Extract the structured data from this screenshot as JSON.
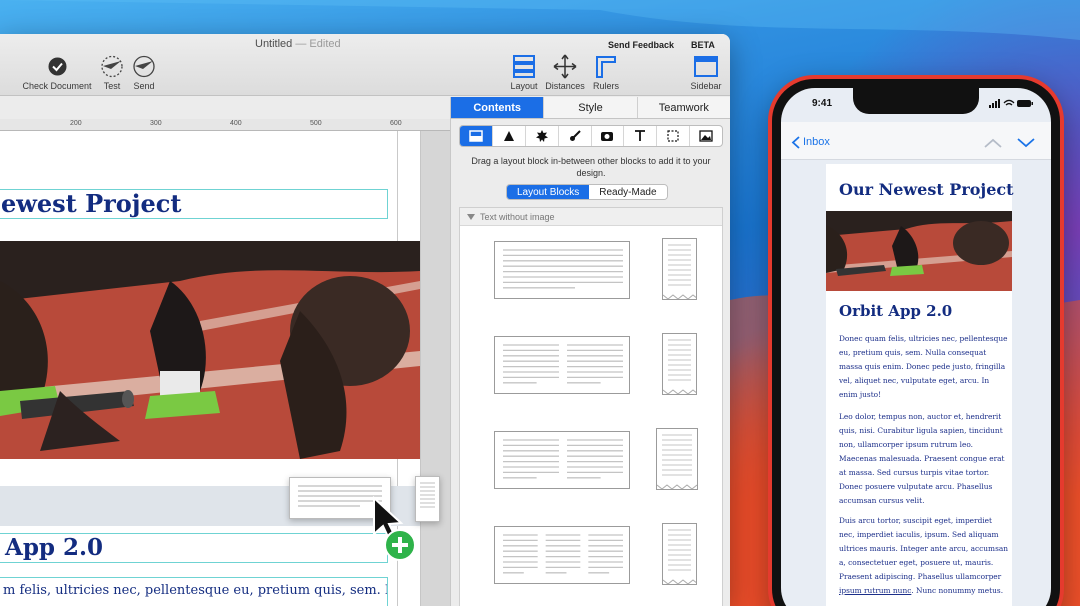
{
  "window": {
    "title": "Untitled",
    "title_sep": " — ",
    "title_state": "Edited",
    "send_feedback": "Send Feedback",
    "beta": "BETA"
  },
  "toolbar": {
    "check_document": "Check Document",
    "test": "Test",
    "send": "Send",
    "layout": "Layout",
    "distances": "Distances",
    "rulers": "Rulers",
    "sidebar": "Sidebar"
  },
  "ruler": {
    "ticks": [
      "200",
      "300",
      "400",
      "500",
      "600"
    ]
  },
  "canvas": {
    "headline": "Newest Project",
    "subheadline": "App 2.0",
    "body": "m felis, ultricies nec, pellentesque eu, pretium quis, sem. Nulla"
  },
  "sidebar": {
    "tabs": [
      "Contents",
      "Style",
      "Teamwork"
    ],
    "active_tab": "Contents",
    "icons": [
      "layout-block-icon",
      "shape-triangle-icon",
      "badge-burst-icon",
      "brush-icon",
      "camera-icon",
      "text-icon",
      "selection-icon",
      "image-icon"
    ],
    "hint": "Drag a layout block in-between other blocks to add it to your design.",
    "segments": [
      "Layout Blocks",
      "Ready-Made"
    ],
    "active_segment": "Layout Blocks",
    "section_title": "Text without image"
  },
  "phone": {
    "time": "9:41",
    "back_label": "Inbox",
    "email": {
      "title": "Our Newest Project",
      "subtitle": "Orbit App 2.0",
      "p1": "Donec quam felis, ultricies nec, pellentesque eu, pretium quis, sem. Nulla consequat massa quis enim. Donec pede justo, fringilla vel, aliquet nec, vulputate eget, arcu. In enim justo!",
      "p2": "Leo dolor, tempus non, auctor et, hendrerit quis, nisi. Curabitur ligula sapien, tincidunt non, ullamcorper ipsum rutrum leo. Maecenas malesuada. Praesent congue erat at massa. Sed cursus turpis vitae tortor. Donec posuere vulputate arcu. Phasellus accumsan cursus velit.",
      "p3_a": "Duis arcu tortor, suscipit eget, imperdiet nec, imperdiet iaculis, ipsum. Sed aliquam ultrices mauris. Integer ante arcu, accumsan a, consectetuer eget, posuere ut, mauris. Praesent adipiscing. Phasellus ullamcorper ",
      "p3_link": "ipsum rutrum nunc",
      "p3_b": ". Nunc nonummy metus."
    }
  },
  "colors": {
    "accent": "#1b6ee6",
    "headline": "#132c80",
    "phone_frame": "#e53a2e",
    "add_green": "#2fb34a"
  }
}
